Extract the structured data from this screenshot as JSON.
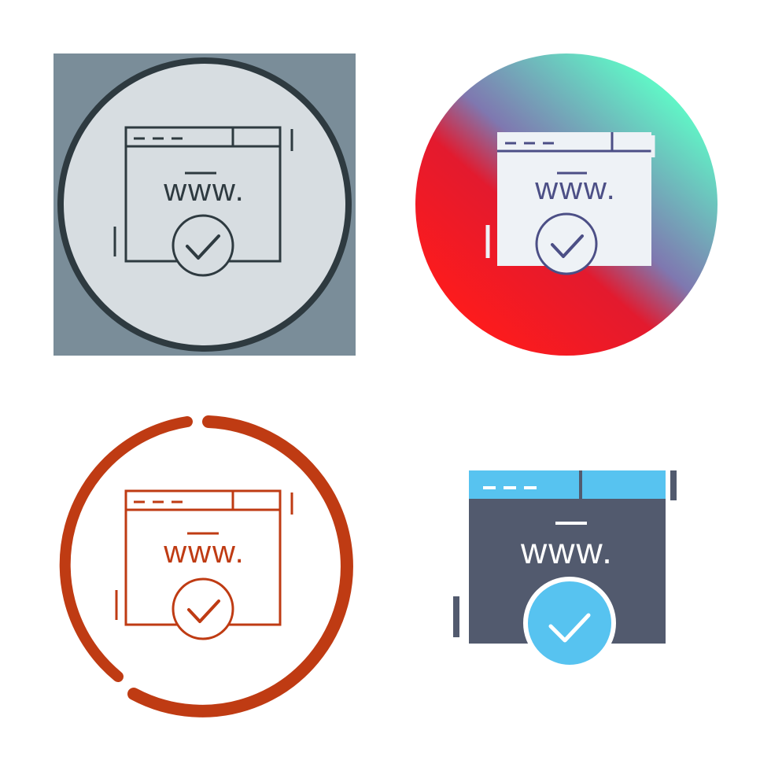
{
  "icons": [
    {
      "style": "line",
      "www_text": "www.",
      "colors": {
        "background": "#7a8d99",
        "circle_fill": "#d7dde1",
        "circle_stroke": "#2e3a40",
        "line": "#2e3a40"
      }
    },
    {
      "style": "gradient",
      "www_text": "www.",
      "colors": {
        "gradient_start": "#ff1b1b",
        "gradient_mid": "#7f78b0",
        "gradient_end": "#5effc8",
        "glyph_fill": "#eef2f6",
        "glyph_line": "#4c4f86"
      }
    },
    {
      "style": "outline-orange",
      "www_text": "www.",
      "colors": {
        "ring": "#bf3b13",
        "line": "#bf3b13"
      }
    },
    {
      "style": "flat",
      "www_text": "www.",
      "colors": {
        "header": "#57c3f0",
        "body": "#525a6e",
        "check_circle": "#57c3f0",
        "light": "#ffffff"
      }
    }
  ]
}
